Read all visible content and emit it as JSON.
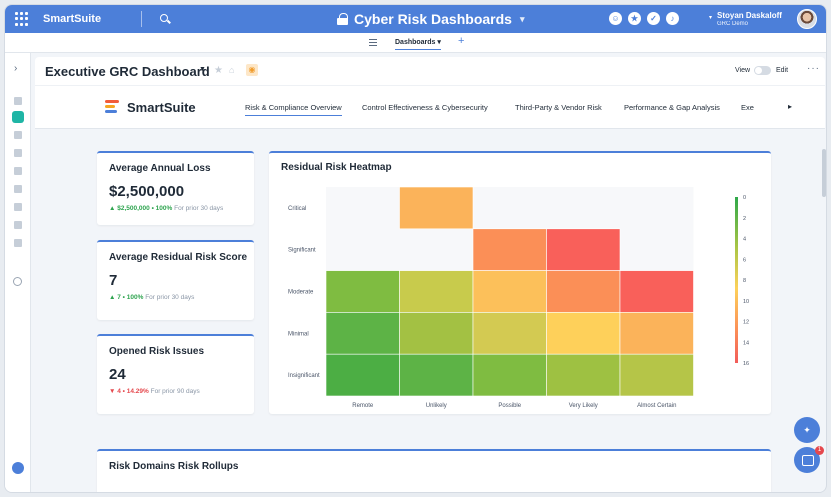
{
  "app": {
    "brand": "SmartSuite",
    "title": "Cyber Risk Dashboards",
    "user_name": "Stoyan Daskaloff",
    "user_org": "GRC Demo"
  },
  "tabstrip": {
    "active_tab": "Dashboards"
  },
  "header": {
    "title": "Executive GRC Dashboard",
    "view_label": "View",
    "edit_label": "Edit"
  },
  "innernav": {
    "logo_text": "SmartSuite",
    "tabs": [
      "Risk & Compliance Overview",
      "Control Effectiveness & Cybersecurity",
      "Third-Party & Vendor Risk",
      "Performance & Gap Analysis",
      "Exe"
    ]
  },
  "cards": [
    {
      "title": "Average Annual Loss",
      "value": "$2,500,000",
      "trend": "$2,500,000 • 100%",
      "trend_dir": "up",
      "period": "For prior 30 days"
    },
    {
      "title": "Average Residual Risk Score",
      "value": "7",
      "trend": "7 • 100%",
      "trend_dir": "up",
      "period": "For prior 30 days"
    },
    {
      "title": "Opened Risk Issues",
      "value": "24",
      "trend": "4 • 14.29%",
      "trend_dir": "down",
      "period": "For prior 90 days"
    }
  ],
  "bottom_card": {
    "title": "Risk Domains Risk Rollups"
  },
  "notifications": {
    "count": "1"
  },
  "chart_data": {
    "type": "heatmap",
    "title": "Residual Risk Heatmap",
    "x_categories": [
      "Remote",
      "Unlikely",
      "Possible",
      "Very Likely",
      "Almost Certain"
    ],
    "y_categories": [
      "Critical",
      "Significant",
      "Moderate",
      "Minimal",
      "Insignificant"
    ],
    "cells": [
      [
        null,
        8,
        null,
        null,
        null
      ],
      [
        null,
        null,
        12,
        16,
        null
      ],
      [
        2,
        5,
        8,
        12,
        16
      ],
      [
        2,
        4,
        6,
        8,
        10
      ],
      [
        1,
        2,
        3,
        4,
        5
      ]
    ],
    "colors": [
      [
        null,
        "#fbb35a",
        null,
        null,
        null
      ],
      [
        null,
        null,
        "#fb8f57",
        "#f9605a",
        null
      ],
      [
        "#7fbc41",
        "#c8cb4c",
        "#fcc05a",
        "#fb8f57",
        "#f9605a"
      ],
      [
        "#5db346",
        "#a3c143",
        "#d3ca52",
        "#fed05a",
        "#fbb35a"
      ],
      [
        "#4cae44",
        "#5db346",
        "#7fbc41",
        "#9ec142",
        "#b5c548"
      ]
    ],
    "legend_ticks": [
      "0",
      "2",
      "4",
      "6",
      "8",
      "10",
      "12",
      "14",
      "16"
    ],
    "legend_range": [
      0,
      16
    ],
    "legend_position": "right"
  }
}
